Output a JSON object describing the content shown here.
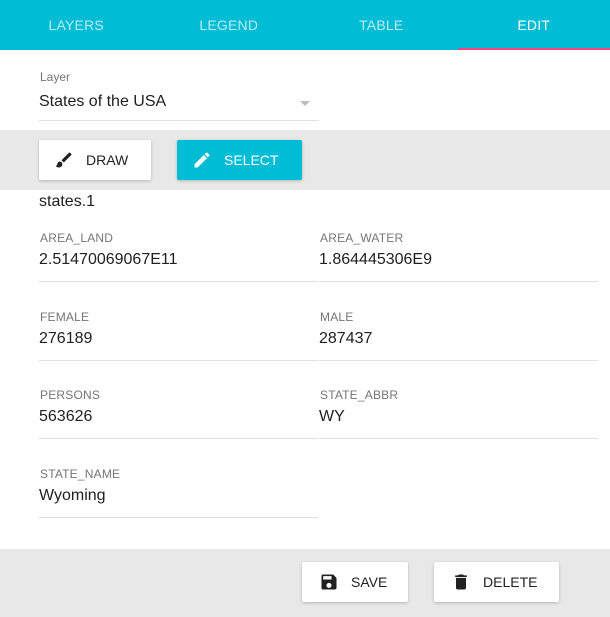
{
  "tabs": [
    {
      "label": "LAYERS"
    },
    {
      "label": "LEGEND"
    },
    {
      "label": "TABLE"
    },
    {
      "label": "EDIT"
    }
  ],
  "active_tab": "EDIT",
  "layer": {
    "label": "Layer",
    "value": "States of the USA"
  },
  "toolbar": {
    "draw_label": "DRAW",
    "select_label": "SELECT"
  },
  "feature": {
    "id": "states.1",
    "fields": [
      {
        "name": "AREA_LAND",
        "value": "2.51470069067E11"
      },
      {
        "name": "AREA_WATER",
        "value": "1.864445306E9"
      },
      {
        "name": "FEMALE",
        "value": "276189"
      },
      {
        "name": "MALE",
        "value": "287437"
      },
      {
        "name": "PERSONS",
        "value": "563626"
      },
      {
        "name": "STATE_ABBR",
        "value": "WY"
      },
      {
        "name": "STATE_NAME",
        "value": "Wyoming"
      }
    ]
  },
  "footer": {
    "save_label": "SAVE",
    "delete_label": "DELETE"
  },
  "colors": {
    "accent": "#00bcd4",
    "tab_indicator": "#ff4081",
    "toolbar_bg": "#e8e8e8"
  },
  "icons": {
    "draw": "brush-icon",
    "select": "pencil-icon",
    "save": "floppy-disk-icon",
    "delete": "trash-icon",
    "dropdown": "caret-down-icon"
  }
}
